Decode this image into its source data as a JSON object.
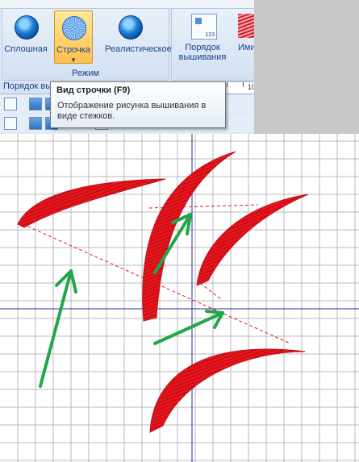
{
  "ribbon": {
    "mode_group": {
      "label": "Режим",
      "buttons": [
        {
          "label": "Сплошная",
          "icon": "solid-view-icon"
        },
        {
          "label": "Строчка",
          "icon": "stitch-view-icon",
          "active": true
        },
        {
          "label": "Реалистическое",
          "icon": "realistic-view-icon"
        }
      ]
    },
    "sequence_group": {
      "buttons": [
        {
          "label_line1": "Порядок",
          "label_line2": "вышивания",
          "icon": "sewing-order-icon"
        },
        {
          "label_line1": "Ими",
          "icon": "simulation-icon"
        }
      ]
    },
    "subbar_label": "Порядок вы",
    "ruler_value": "10"
  },
  "tooltip": {
    "title": "Вид строчки (F9)",
    "body": "Отображение рисунка вышивания в виде стежков."
  },
  "colors": {
    "stitch_red": "#e8141c",
    "arrow_green": "#22a64a",
    "axis_blue": "#2b2b8c",
    "grid": "#b8b8b8"
  }
}
